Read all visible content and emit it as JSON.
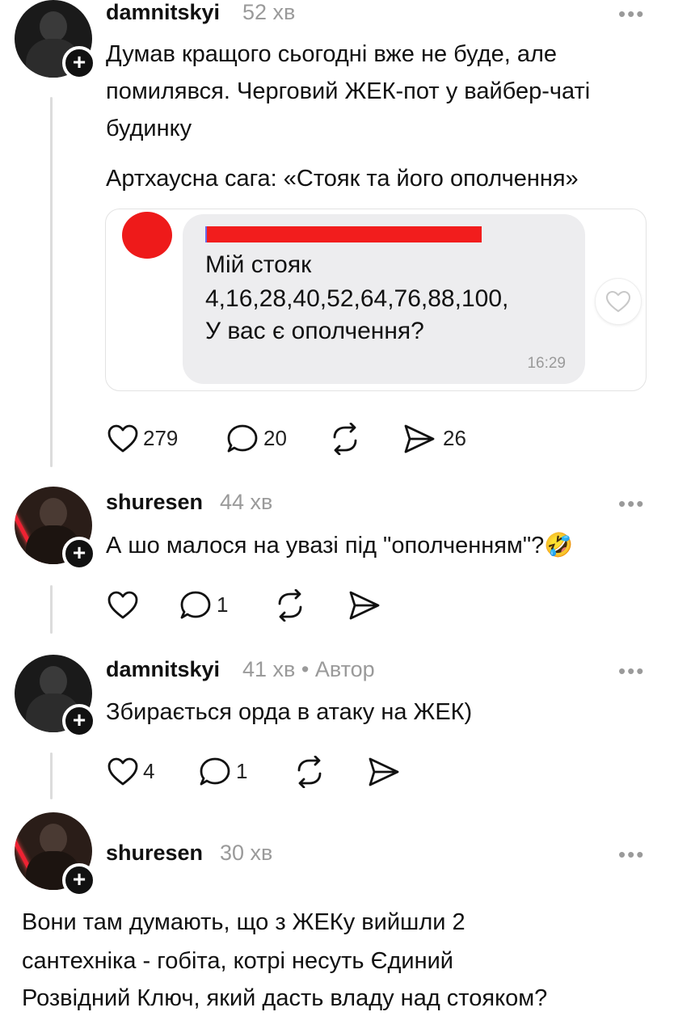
{
  "posts": [
    {
      "username": "damnitskyi",
      "time": "52 хв",
      "text_lines": [
        "Думав кращого сьогодні вже не буде, але",
        "помилявся. Черговий ЖЕК-пот у вайбер-чаті",
        "будинку"
      ],
      "subtext": "Артхаусна сага: «Стояк та його ополчення»",
      "embed": {
        "lines": [
          "Мій стояк",
          "4,16,28,40,52,64,76,88,100,",
          "У вас є ополчення?"
        ],
        "time": "16:29"
      },
      "likes": "279",
      "replies": "20",
      "shares": "26"
    },
    {
      "username": "shuresen",
      "time": "44 хв",
      "text": "А шо малося на увазі під \"ополченням\"?🤣",
      "replies": "1"
    },
    {
      "username": "damnitskyi",
      "time": "41 хв • Автор",
      "text": "Збирається орда в атаку на ЖЕК)",
      "likes": "4",
      "replies": "1"
    },
    {
      "username": "shuresen",
      "time": "30 хв",
      "text_lines": [
        "Вони там думають, що з ЖЕКу вийшли 2",
        "сантехніка - гобіта, котрі несуть Єдиний",
        "Розвідний Ключ, який дасть владу над стояком?"
      ]
    }
  ],
  "ui": {
    "more": "•••",
    "plus": "+"
  }
}
